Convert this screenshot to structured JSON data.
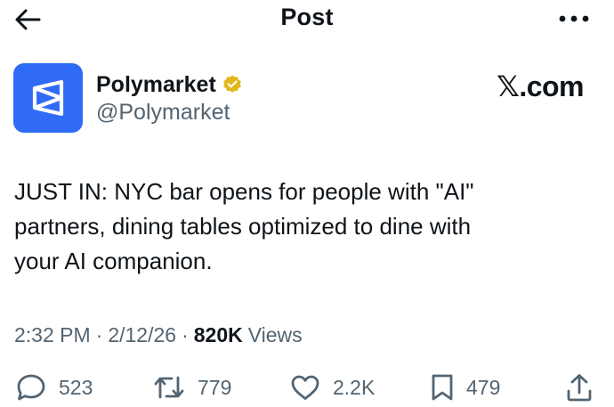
{
  "header": {
    "title": "Post",
    "back_icon": "arrow-left-icon",
    "more_icon": "more-horizontal-icon"
  },
  "author": {
    "name": "Polymarket",
    "handle": "@Polymarket",
    "verified": true,
    "badge_color": "#e2b719",
    "avatar_color": "#2f6bf5"
  },
  "source_label": "𝕏.com",
  "post": {
    "text": "JUST IN: NYC bar opens for people with \"AI\"\npartners, dining tables optimized to dine with\nyour AI companion."
  },
  "meta": {
    "time": "2:32 PM",
    "separator": "·",
    "date": "2/12/26",
    "views_count": "820K",
    "views_label": "Views"
  },
  "actions": {
    "replies": {
      "icon": "reply-icon",
      "count": "523"
    },
    "reposts": {
      "icon": "repost-icon",
      "count": "779"
    },
    "likes": {
      "icon": "like-icon",
      "count": "2.2K"
    },
    "bookmarks": {
      "icon": "bookmark-icon",
      "count": "479"
    },
    "share": {
      "icon": "share-icon"
    }
  }
}
